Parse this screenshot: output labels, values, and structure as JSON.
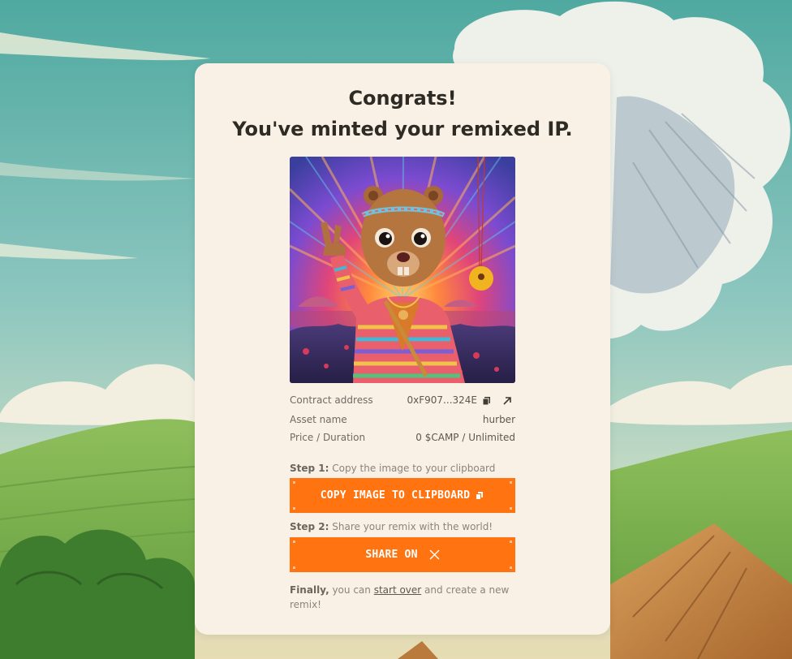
{
  "card": {
    "title_line1": "Congrats!",
    "title_line2": "You've minted your remixed IP."
  },
  "image": {
    "subject": "knitted beaver character making a peace sign at a festival sunset"
  },
  "details": {
    "contract_label": "Contract address",
    "contract_value": "0xF907...324E",
    "asset_label": "Asset name",
    "asset_value": "hurber",
    "price_label": "Price / Duration",
    "price_value": "0 $CAMP / Unlimited"
  },
  "step1": {
    "prefix": "Step 1:",
    "text": " Copy the image to your clipboard",
    "button_label": "COPY IMAGE TO CLIPBOARD"
  },
  "step2": {
    "prefix": "Step 2:",
    "text": " Share your remix with the world!",
    "button_label": "SHARE ON"
  },
  "final": {
    "prefix": "Finally,",
    "text_before": " you can ",
    "link": "start over",
    "text_after": " and create a new remix!"
  },
  "colors": {
    "accent": "#ff7411",
    "card_bg": "#f9f1e6"
  },
  "icons": [
    "copy-icon",
    "external-link-icon",
    "x-logo-icon"
  ]
}
